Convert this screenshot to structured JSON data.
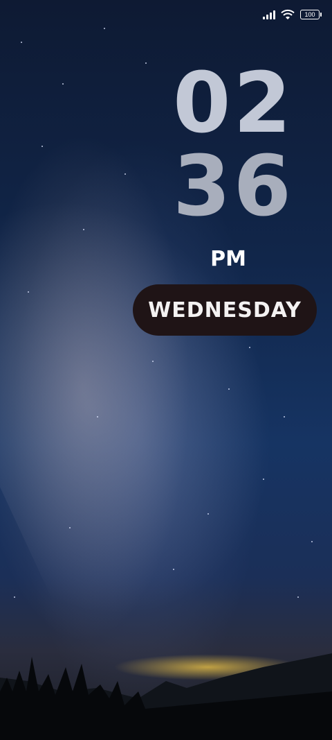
{
  "status_bar": {
    "signal_icon": "cell-signal-icon",
    "wifi_icon": "wifi-icon",
    "battery_icon": "battery-icon",
    "battery_level": "100"
  },
  "clock": {
    "hours": "02",
    "minutes": "36",
    "ampm": "PM",
    "day": "WEDNESDAY"
  },
  "colors": {
    "clock_digits": "#c2c8d6",
    "pill_background": "#1f1416",
    "sky_top": "#0e1a33",
    "horizon_glow": "#e6be46"
  }
}
